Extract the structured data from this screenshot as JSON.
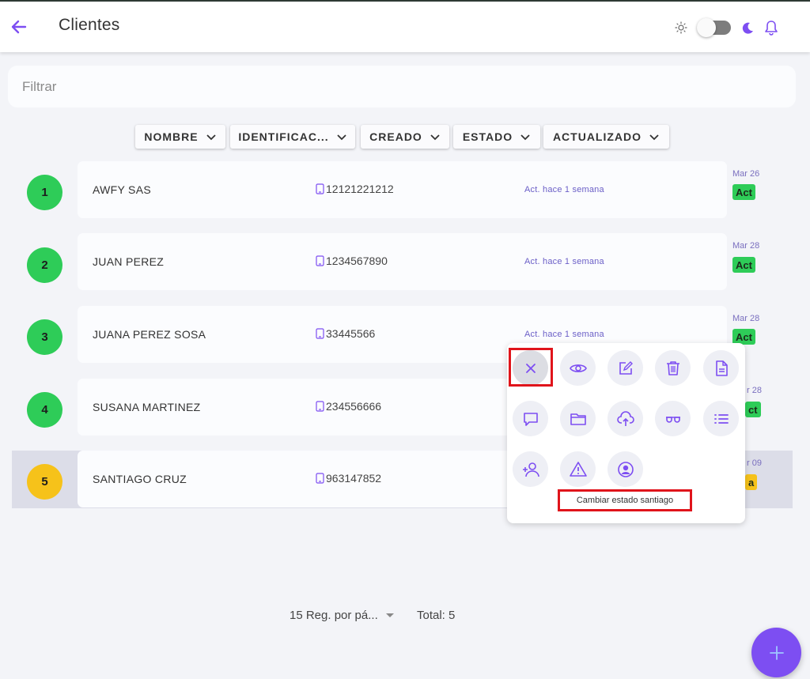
{
  "header": {
    "title": "Clientes",
    "icons": [
      "back-arrow-icon",
      "sun-icon",
      "theme-toggle",
      "moon-icon",
      "bell-icon"
    ]
  },
  "filter": {
    "placeholder": "Filtrar",
    "value": ""
  },
  "sort_buttons": [
    {
      "label": "NOMBRE"
    },
    {
      "label": "IDENTIFICAC..."
    },
    {
      "label": "CREADO"
    },
    {
      "label": "ESTADO"
    },
    {
      "label": "ACTUALIZADO"
    }
  ],
  "clients": [
    {
      "num": "1",
      "name": "AWFY SAS",
      "id": "12121221212",
      "updated": "Act. hace 1 semana",
      "date": "Mar 26",
      "status": "Act"
    },
    {
      "num": "2",
      "name": "JUAN PEREZ",
      "id": "1234567890",
      "updated": "Act. hace 1 semana",
      "date": "Mar 28",
      "status": "Act"
    },
    {
      "num": "3",
      "name": "JUANA PEREZ SOSA",
      "id": "33445566",
      "updated": "Act. hace 1 semana",
      "date": "Mar 28",
      "status": "Act"
    },
    {
      "num": "4",
      "name": "SUSANA MARTINEZ",
      "id": "234556666",
      "date": "r 28",
      "status": "ct"
    },
    {
      "num": "5",
      "name": "SANTIAGO CRUZ",
      "id": "963147852",
      "date": "r 09",
      "status": "a"
    }
  ],
  "action_menu": {
    "tooltip": "Cambiar estado santiago",
    "actions": [
      "close-icon",
      "eye-icon",
      "edit-icon",
      "trash-icon",
      "document-icon",
      "comment-icon",
      "folder-icon",
      "cloud-upload-icon",
      "glasses-icon",
      "list-icon",
      "add-user-icon",
      "warning-icon",
      "user-circle-icon"
    ]
  },
  "pagination": {
    "per_page_label": "15 Reg. por pá...",
    "total_label": "Total: 5"
  },
  "colors": {
    "accent": "#7d4ef2",
    "active": "#2ecc58",
    "pending": "#f6c21a",
    "row_highlight": "#dcdde8"
  }
}
